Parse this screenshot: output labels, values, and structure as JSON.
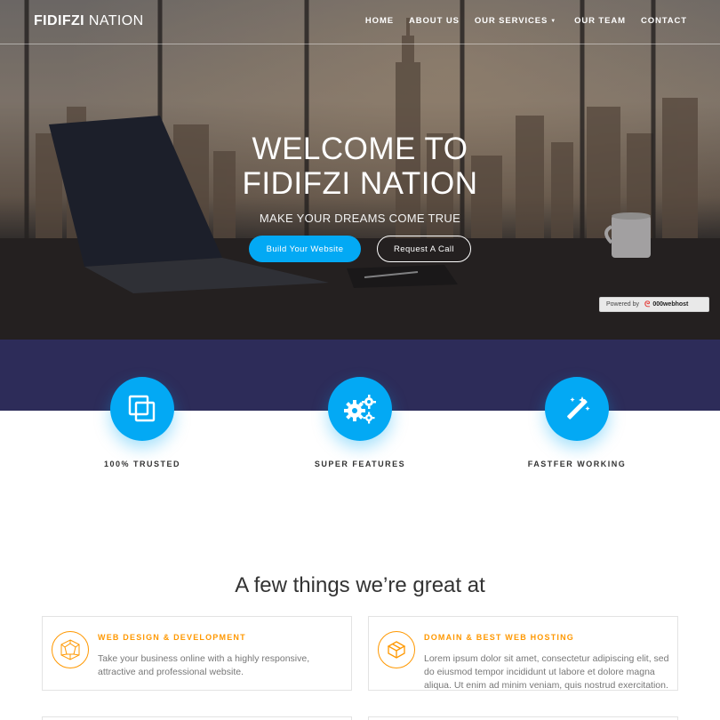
{
  "brand": {
    "bold": "FIDIFZI",
    "light": "NATION"
  },
  "nav": {
    "items": [
      {
        "label": "HOME"
      },
      {
        "label": "ABOUT US"
      },
      {
        "label": "OUR SERVICES",
        "dropdown": true
      },
      {
        "label": "OUR TEAM"
      },
      {
        "label": "CONTACT"
      }
    ]
  },
  "hero": {
    "title_line1": "WELCOME TO",
    "title_line2": "FIDIFZI NATION",
    "subtitle": "MAKE YOUR DREAMS COME TRUE",
    "primary_button": "Build Your Website",
    "secondary_button": "Request A Call"
  },
  "badge": {
    "prefix": "Powered by",
    "host": "000webhost"
  },
  "features": [
    {
      "label": "100% TRUSTED",
      "icon": "copy-icon"
    },
    {
      "label": "SUPER FEATURES",
      "icon": "gears-icon"
    },
    {
      "label": "FASTFER WORKING",
      "icon": "magic-wand-icon"
    }
  ],
  "services": {
    "title": "A few things we’re great at",
    "cards": [
      {
        "title": "WEB DESIGN & DEVELOPMENT",
        "text": "Take your business online with a highly responsive, attractive and professional website.",
        "icon": "polygon-icon"
      },
      {
        "title": "DOMAIN & BEST WEB HOSTING",
        "text": "Lorem ipsum dolor sit amet, consectetur adipiscing elit, sed do eiusmod tempor incididunt ut labore et dolore magna aliqua. Ut enim ad minim veniam, quis nostrud exercitation.",
        "icon": "cube-icon"
      }
    ]
  },
  "colors": {
    "accent": "#03a9f4",
    "band": "#2d2c59",
    "orange": "#ff9800"
  }
}
